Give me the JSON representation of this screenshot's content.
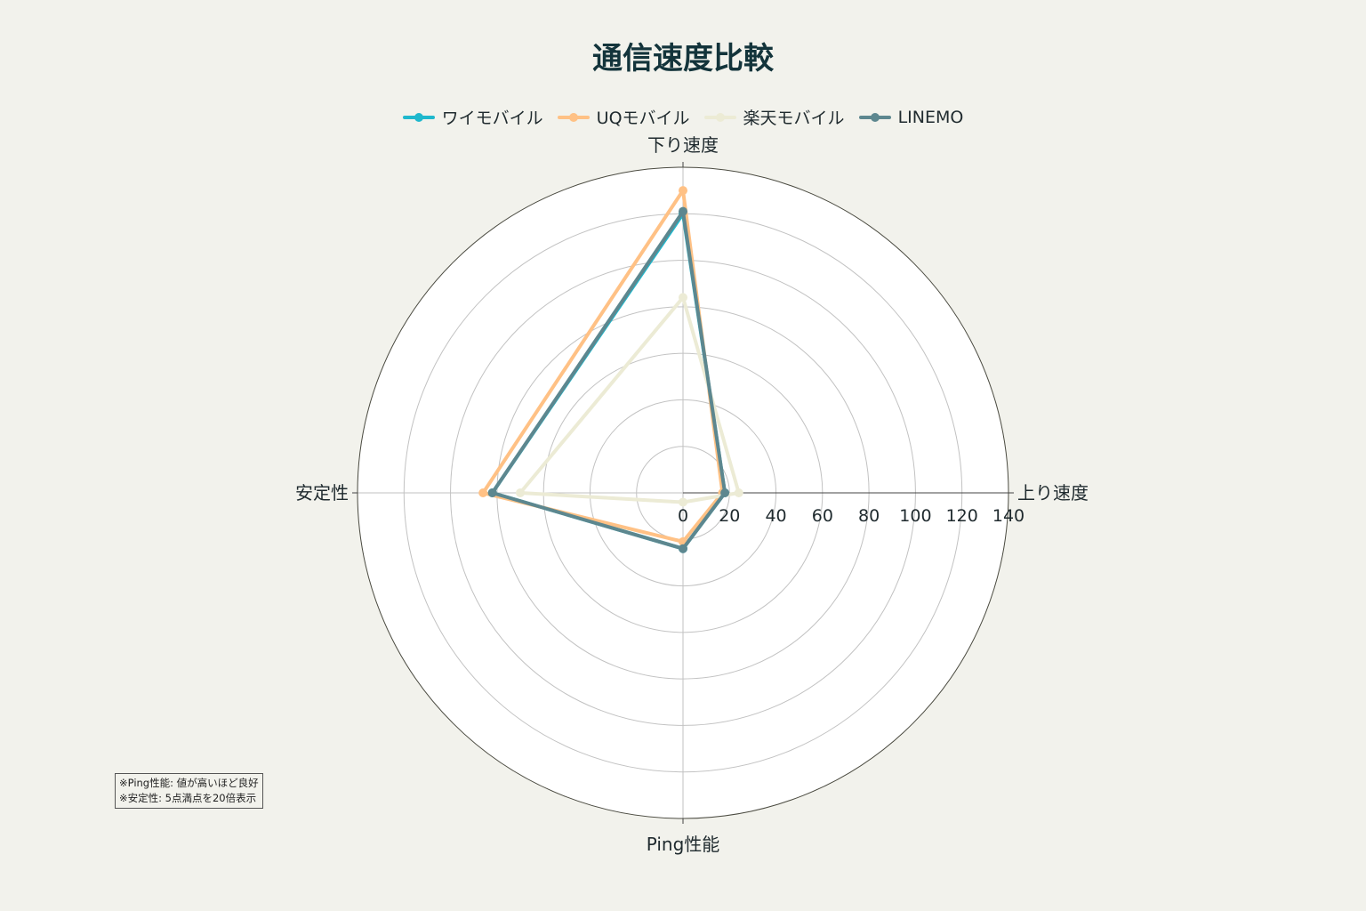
{
  "chart_data": {
    "type": "radar",
    "title": "通信速度比較",
    "axes": [
      "下り速度",
      "上り速度",
      "Ping性能",
      "安定性"
    ],
    "rticks": [
      "0",
      "20",
      "40",
      "60",
      "80",
      "100",
      "120",
      "140"
    ],
    "rlim": [
      0,
      140
    ],
    "legend_position": "top-center",
    "series": [
      {
        "name": "ワイモバイル",
        "color": "#1fb8cd",
        "values": [
          120,
          18,
          24,
          82
        ]
      },
      {
        "name": "UQモバイル",
        "color": "#ffc185",
        "values": [
          130,
          17,
          21,
          86
        ]
      },
      {
        "name": "楽天モバイル",
        "color": "#ecebd5",
        "values": [
          84,
          24,
          4,
          70
        ]
      },
      {
        "name": "LINEMO",
        "color": "#5d878f",
        "values": [
          121,
          18,
          24,
          82
        ]
      }
    ],
    "annotation": [
      "※Ping性能: 値が高いほど良好",
      "※安定性: 5点満点を20倍表示"
    ]
  }
}
